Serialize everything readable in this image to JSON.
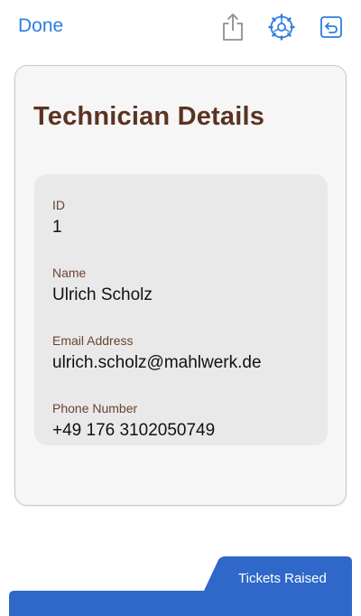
{
  "toolbar": {
    "done_label": "Done",
    "share_icon": "share-icon",
    "gear_icon": "gear-icon",
    "return_icon": "return-icon",
    "accent_color": "#2f7de1"
  },
  "card": {
    "title": "Technician Details",
    "title_color": "#5b3321",
    "fields": [
      {
        "label": "ID",
        "value": "1"
      },
      {
        "label": "Name",
        "value": "Ulrich Scholz"
      },
      {
        "label": "Email Address",
        "value": "ulrich.scholz@mahlwerk.de"
      },
      {
        "label": "Phone Number",
        "value": "+49 176 3102050749"
      }
    ]
  },
  "bottom_tab": {
    "label": "Tickets Raised",
    "color": "#2f68c9"
  }
}
